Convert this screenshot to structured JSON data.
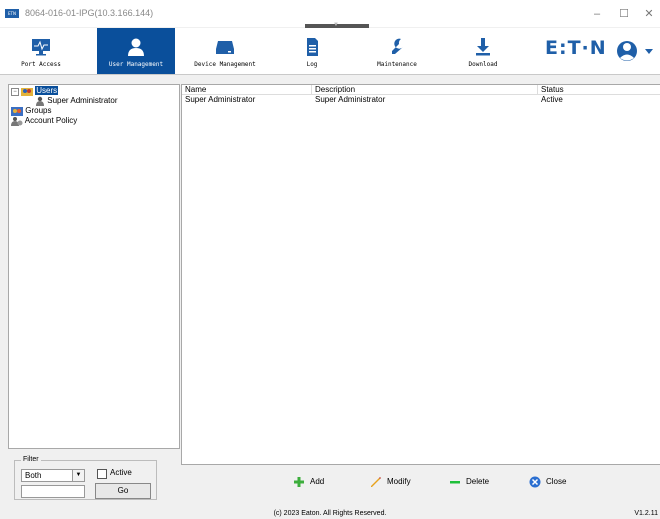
{
  "window": {
    "title": "8064-016-01-IPG(10.3.166.144)",
    "app_icon_text": "ETN",
    "controls": {
      "minimize": "–",
      "maximize": "☐",
      "close": "✕"
    }
  },
  "toolbar": {
    "items": [
      {
        "label": "Port Access",
        "icon": "monitor-icon"
      },
      {
        "label": "User Management",
        "icon": "user-icon",
        "active": true
      },
      {
        "label": "Device Management",
        "icon": "device-icon"
      },
      {
        "label": "Log",
        "icon": "document-icon"
      },
      {
        "label": "Maintenance",
        "icon": "wrench-icon"
      },
      {
        "label": "Download",
        "icon": "download-icon"
      }
    ],
    "brand": "E:T·N",
    "user_menu_icon": "account-icon"
  },
  "tree": {
    "users_label": "Users",
    "user_items": [
      "Super Administrator"
    ],
    "groups_label": "Groups",
    "policy_label": "Account Policy"
  },
  "filter": {
    "legend": "Filter",
    "select_value": "Both",
    "active_label": "Active",
    "active_checked": false,
    "input_value": "",
    "go_label": "Go"
  },
  "table": {
    "columns": [
      "Name",
      "Description",
      "Status"
    ],
    "rows": [
      [
        "Super Administrator",
        "Super Administrator",
        "Active"
      ]
    ]
  },
  "actions": {
    "add": "Add",
    "modify": "Modify",
    "delete": "Delete",
    "close": "Close"
  },
  "status": {
    "copyright": "(c) 2023 Eaton. All Rights Reserved.",
    "version": "V1.2.11"
  },
  "colors": {
    "accent": "#0a4f9b",
    "brand": "#1f5fa8",
    "add": "#3cae3c",
    "delete": "#1fbf3a",
    "close": "#2b6fd1"
  }
}
